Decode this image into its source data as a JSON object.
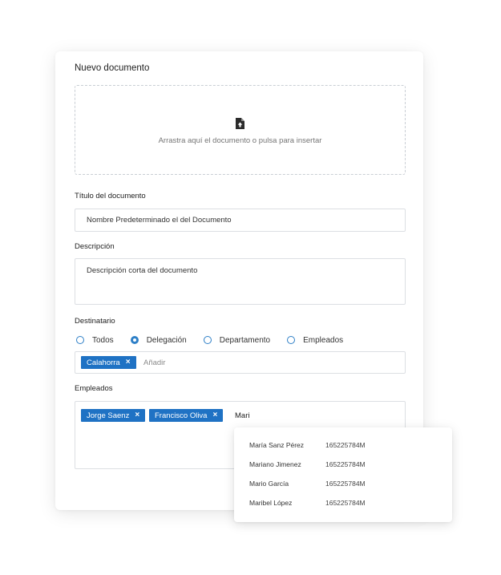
{
  "form": {
    "title": "Nuevo documento",
    "dropzone": {
      "icon": "file-upload-icon",
      "text": "Arrastra aquí el documento o pulsa para insertar"
    },
    "doc_title": {
      "label": "Título del documento",
      "value": "Nombre Predeterminado el del Documento"
    },
    "description": {
      "label": "Descripción",
      "value": "Descripción corta del documento"
    },
    "recipient": {
      "label": "Destinatario",
      "options": [
        "Todos",
        "Delegación",
        "Departamento",
        "Empleados"
      ],
      "selected": "Delegación",
      "chips": [
        "Calahorra"
      ],
      "add_placeholder": "Añadir"
    },
    "employees": {
      "label": "Empleados",
      "chips": [
        "Jorge Saenz",
        "Francisco Oliva"
      ],
      "query": "Mari"
    }
  },
  "suggestions": [
    {
      "name": "María Sanz Pérez",
      "id": "165225784M"
    },
    {
      "name": "Mariano Jimenez",
      "id": "165225784M"
    },
    {
      "name": "Mario García",
      "id": "165225784M"
    },
    {
      "name": "Maribel López",
      "id": "165225784M"
    }
  ],
  "colors": {
    "accent": "#1f72c4",
    "radio": "#2d7fc7",
    "border": "#dcdfe3",
    "chip_remove": "close-icon"
  }
}
